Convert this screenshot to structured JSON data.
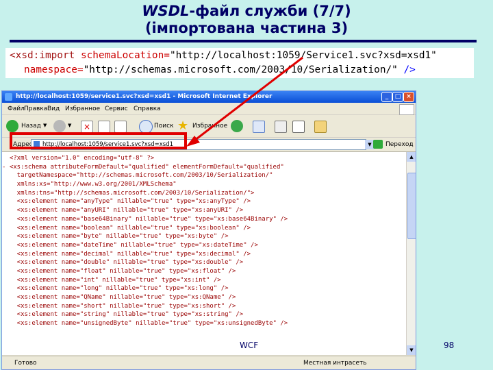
{
  "slide": {
    "title_italic": "WSDL",
    "title_rest": "-файл служби  (7/7)",
    "subtitle": "(імпортована частина 3)",
    "footer_wcf": "WCF",
    "page_number": "98"
  },
  "code": {
    "l1_tag": "<xsd:import ",
    "l1_attr": "schemaLocation=",
    "l1_val": "\"http://localhost:1059/Service1.svc?xsd=xsd1\"",
    "l2_attr": "namespace=",
    "l2_val": "\"http://schemas.microsoft.com/2003/10/Serialization/\"",
    "l2_end": " />"
  },
  "browser": {
    "window_title": "http://localhost:1059/service1.svc?xsd=xsd1 - Microsoft Internet Explorer",
    "menu": [
      "Файл",
      "Правка",
      "Вид",
      "Избранное",
      "Сервис",
      "Справка"
    ],
    "toolbar": {
      "back": "Назад",
      "search": "Поиск",
      "favorites": "Избранное"
    },
    "address_label": "Адрес:",
    "address_url": "http://localhost:1059/service1.svc?xsd=xsd1",
    "go_label": "Переход",
    "status_text": "Готово",
    "zone_text": "Местная интрасеть",
    "xml_lines": [
      "  <?xml version=\"1.0\" encoding=\"utf-8\" ?>",
      "- <xs:schema attributeFormDefault=\"qualified\" elementFormDefault=\"qualified\"",
      "    targetNamespace=\"http://schemas.microsoft.com/2003/10/Serialization/\"",
      "    xmlns:xs=\"http://www.w3.org/2001/XMLSchema\"",
      "    xmlns:tns=\"http://schemas.microsoft.com/2003/10/Serialization/\">",
      "    <xs:element name=\"anyType\" nillable=\"true\" type=\"xs:anyType\" />",
      "    <xs:element name=\"anyURI\" nillable=\"true\" type=\"xs:anyURI\" />",
      "    <xs:element name=\"base64Binary\" nillable=\"true\" type=\"xs:base64Binary\" />",
      "    <xs:element name=\"boolean\" nillable=\"true\" type=\"xs:boolean\" />",
      "    <xs:element name=\"byte\" nillable=\"true\" type=\"xs:byte\" />",
      "    <xs:element name=\"dateTime\" nillable=\"true\" type=\"xs:dateTime\" />",
      "    <xs:element name=\"decimal\" nillable=\"true\" type=\"xs:decimal\" />",
      "    <xs:element name=\"double\" nillable=\"true\" type=\"xs:double\" />",
      "    <xs:element name=\"float\" nillable=\"true\" type=\"xs:float\" />",
      "    <xs:element name=\"int\" nillable=\"true\" type=\"xs:int\" />",
      "    <xs:element name=\"long\" nillable=\"true\" type=\"xs:long\" />",
      "    <xs:element name=\"QName\" nillable=\"true\" type=\"xs:QName\" />",
      "    <xs:element name=\"short\" nillable=\"true\" type=\"xs:short\" />",
      "    <xs:element name=\"string\" nillable=\"true\" type=\"xs:string\" />",
      "    <xs:element name=\"unsignedByte\" nillable=\"true\" type=\"xs:unsignedByte\" />"
    ]
  },
  "colors": {
    "background": "#c7f1ec",
    "title": "#000066",
    "highlight_red": "#e00000"
  }
}
